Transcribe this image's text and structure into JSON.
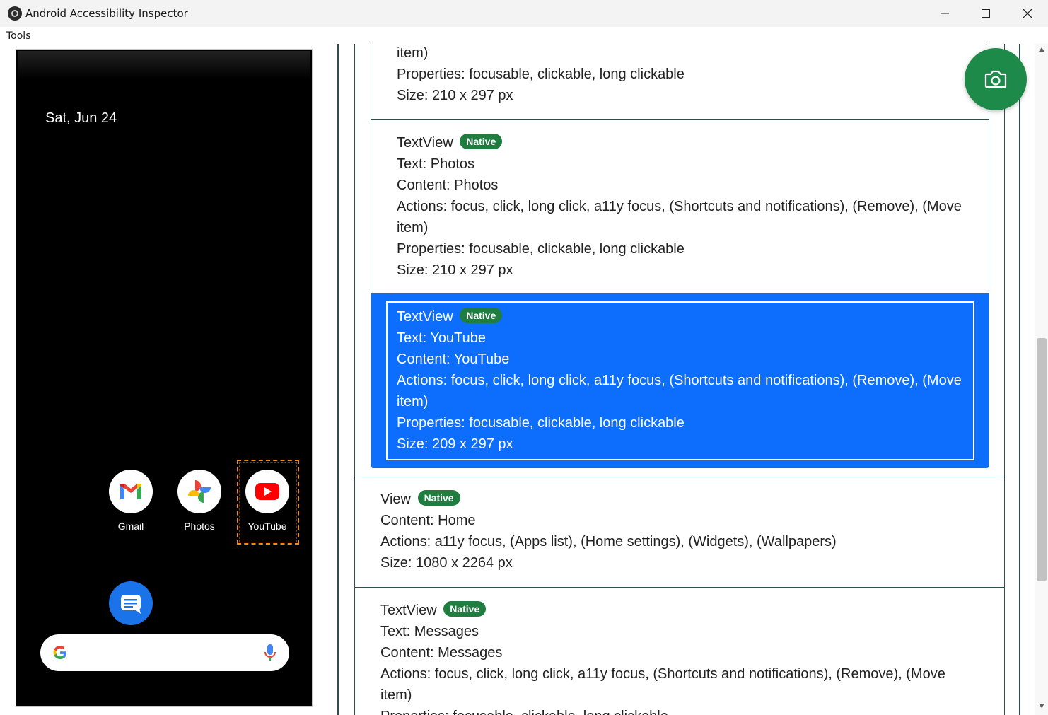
{
  "window": {
    "title": "Android Accessibility Inspector",
    "controls": {
      "minimize": "minimize",
      "maximize": "maximize",
      "close": "close"
    }
  },
  "menu": {
    "tools": "Tools"
  },
  "phone": {
    "date": "Sat, Jun 24",
    "apps": [
      {
        "label": "Gmail",
        "icon": "gmail-icon"
      },
      {
        "label": "Photos",
        "icon": "photos-icon"
      },
      {
        "label": "YouTube",
        "icon": "youtube-icon"
      }
    ],
    "dock": {
      "icon": "messages-icon"
    },
    "search": {
      "left_icon": "google-g-icon",
      "right_icon": "microphone-icon"
    }
  },
  "elements": [
    {
      "lines": [
        "item)",
        "Properties: focusable, clickable, long clickable",
        "Size: 210 x 297 px"
      ]
    },
    {
      "type": "TextView",
      "badge": "Native",
      "lines": [
        "Text: Photos",
        "Content: Photos",
        "Actions: focus, click, long click, a11y focus, (Shortcuts and notifications), (Remove), (Move",
        "item)",
        "Properties: focusable, clickable, long clickable",
        "Size: 210 x 297 px"
      ]
    },
    {
      "type": "TextView",
      "badge": "Native",
      "selected": true,
      "lines": [
        "Text: YouTube",
        "Content: YouTube",
        "Actions: focus, click, long click, a11y focus, (Shortcuts and notifications), (Remove), (Move",
        "item)",
        "Properties: focusable, clickable, long clickable",
        "Size: 209 x 297 px"
      ]
    },
    {
      "type": "View",
      "badge": "Native",
      "lines": [
        "Content: Home",
        "Actions: a11y focus, (Apps list), (Home settings), (Widgets), (Wallpapers)",
        "Size: 1080 x 2264 px"
      ]
    },
    {
      "type": "TextView",
      "badge": "Native",
      "lines": [
        "Text: Messages",
        "Content: Messages",
        "Actions: focus, click, long click, a11y focus, (Shortcuts and notifications), (Remove), (Move",
        "item)",
        "Properties: focusable, clickable, long clickable"
      ]
    }
  ],
  "fab": {
    "icon": "camera-icon"
  },
  "colors": {
    "selected": "#0d6efd",
    "badge": "#1e7d3f",
    "fab": "#1e8a4a",
    "highlight": "#f08a16"
  }
}
